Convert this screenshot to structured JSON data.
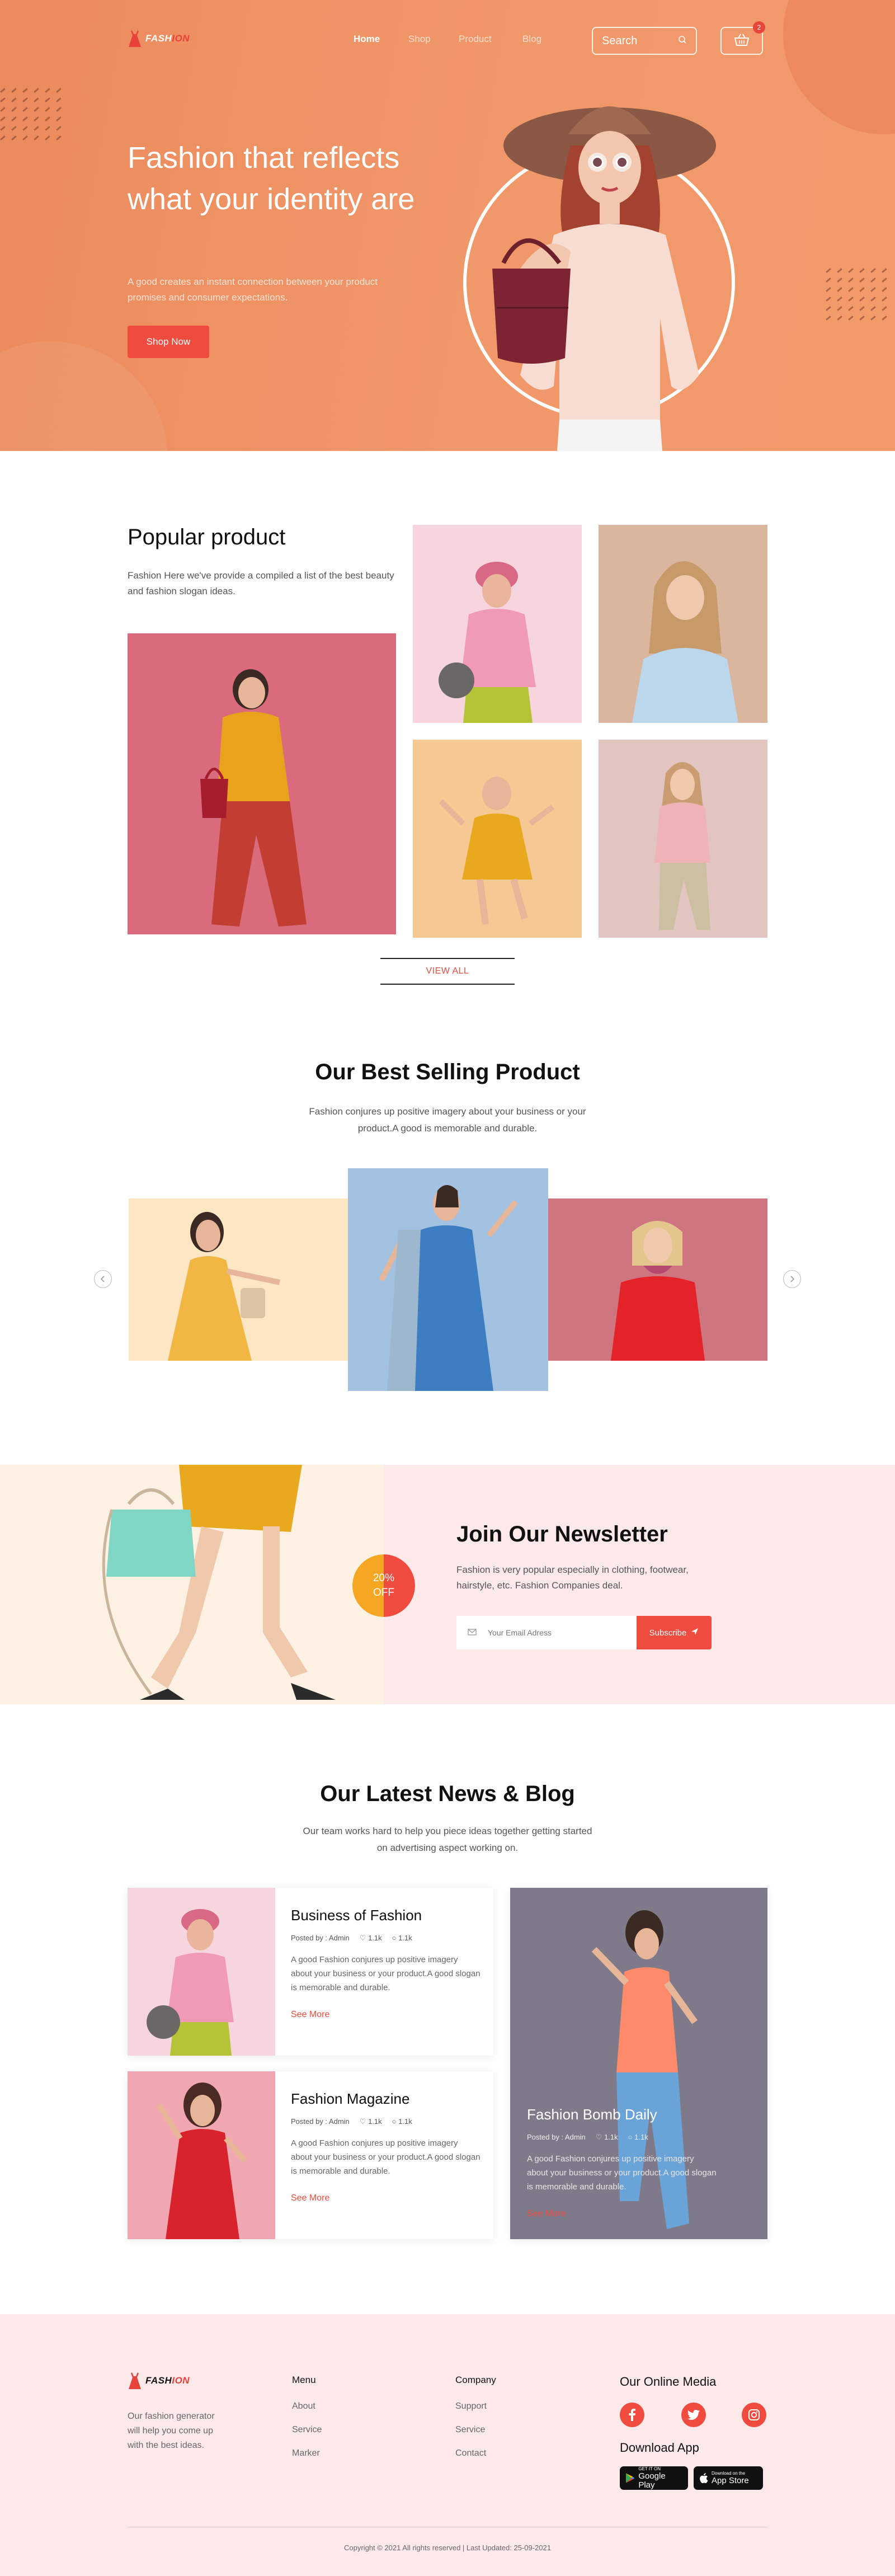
{
  "brand": {
    "logo_text_part1": "FASH",
    "logo_text_part2": "ION",
    "accent": "#ef4b3f",
    "hero_bg": "#f0936a"
  },
  "nav": {
    "items": [
      "Home",
      "Shop",
      "Product",
      "Blog"
    ]
  },
  "search": {
    "placeholder": "Search"
  },
  "cart": {
    "count": "2"
  },
  "hero": {
    "title": "Fashion that reflects what your identity are",
    "subtitle": "A good creates an instant connection between your product promises and consumer expectations.",
    "cta": "Shop Now"
  },
  "popular": {
    "title": "Popular product",
    "subtitle": "Fashion Here we've provide a compiled a list of the best beauty and fashion slogan ideas.",
    "view_all": "VIEW ALL"
  },
  "best": {
    "title": "Our Best Selling Product",
    "subtitle": "Fashion conjures up positive imagery about your business or your product.A good is memorable and durable."
  },
  "newsletter": {
    "badge_line1": "20%",
    "badge_line2": "OFF",
    "title": "Join Our Newsletter",
    "subtitle": "Fashion is very popular especially in clothing, footwear, hairstyle, etc. Fashion Companies deal.",
    "placeholder": "Your Email Adress",
    "button": "Subscribe"
  },
  "news": {
    "title": "Our Latest News & Blog",
    "subtitle": "Our team works hard to help you piece ideas together getting started on advertising aspect working on.",
    "posts": [
      {
        "title": "Business of Fashion",
        "author": "Posted by : Admin",
        "likes": "1.1k",
        "comments": "1.1k",
        "text": "A good Fashion conjures up positive imagery about your business or your product.A good slogan is memorable and durable.",
        "more": "See More"
      },
      {
        "title": "Fashion Magazine",
        "author": "Posted by : Admin",
        "likes": "1.1k",
        "comments": "1.1k",
        "text": "A good Fashion conjures up positive imagery about your business or your product.A good slogan is memorable and durable.",
        "more": "See More"
      },
      {
        "title": "Fashion Bomb Daily",
        "author": "Posted by : Admin",
        "likes": "1.1k",
        "comments": "1.1k",
        "text": "A good Fashion conjures up positive imagery about your business or your product.A good slogan is memorable and durable.",
        "more": "See More"
      }
    ]
  },
  "footer": {
    "about": "Our fashion generator will help you come up with the best ideas.",
    "menu_title": "Menu",
    "menu_items": [
      "About",
      "Service",
      "Marker"
    ],
    "company_title": "Company",
    "company_items": [
      "Support",
      "Service",
      "Contact"
    ],
    "social_title": "Our Online Media",
    "social_icons": [
      "facebook-icon",
      "twitter-icon",
      "instagram-icon"
    ],
    "app_title": "Download App",
    "google_small": "GET IT ON",
    "google_big": "Google Play",
    "apple_small": "Download on the",
    "apple_big": "App Store",
    "copyright": "Copyright © 2021 All rights reserved | Last Updated: 25-09-2021"
  }
}
